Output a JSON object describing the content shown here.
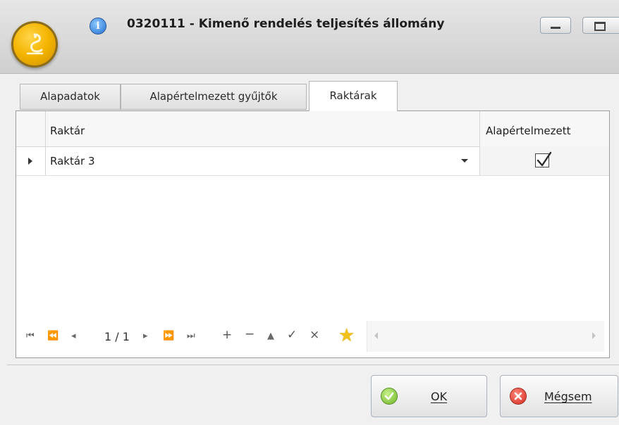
{
  "window": {
    "title": "0320111 - Kimenő rendelés teljesítés állomány",
    "icons": {
      "app": "cobra-logo-icon",
      "info": "info-icon"
    },
    "buttons": {
      "minimize": "minimize-icon",
      "maximize": "maximize-icon"
    }
  },
  "tabs": [
    {
      "label": "Alapadatok",
      "active": false
    },
    {
      "label": "Alapértelmezett gyűjtők",
      "active": false
    },
    {
      "label": "Raktárak",
      "active": true
    }
  ],
  "grid": {
    "columns": [
      "Raktár",
      "Alapértelmezett"
    ],
    "rows": [
      {
        "raktar": "Raktár 3",
        "alapertelmezett": true
      }
    ]
  },
  "navigator": {
    "page_text": "1 / 1",
    "icons": [
      "first-icon",
      "prev-page-icon",
      "prev-icon",
      "next-icon",
      "next-page-icon",
      "last-icon",
      "add-icon",
      "remove-icon",
      "edit-icon",
      "accept-icon",
      "cancel-edit-icon",
      "favorite-star-icon"
    ]
  },
  "footer": {
    "ok_label": "OK",
    "cancel_label": "Mégsem"
  },
  "colors": {
    "accent_star": "#f1c21b",
    "ok_icon": "#6bb323",
    "cancel_icon": "#d4261b"
  }
}
